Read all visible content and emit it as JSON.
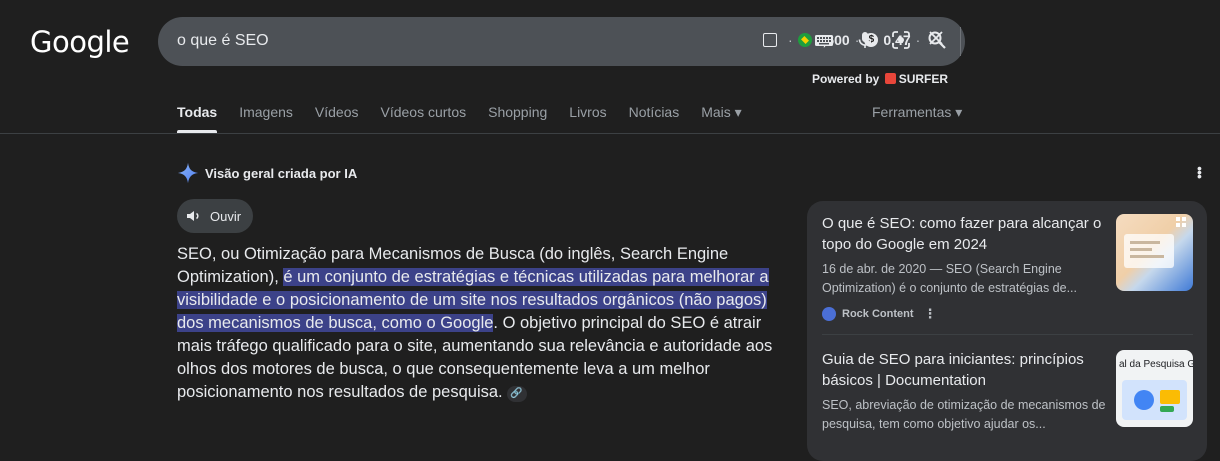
{
  "header": {
    "logo": "Google",
    "query": "o que é SEO",
    "ext_volume": "6,600",
    "ext_cpc": "0.47",
    "dot": "·",
    "powered_by": "Powered by",
    "surfer": "SURFER"
  },
  "tabs": [
    {
      "label": "Todas",
      "active": true
    },
    {
      "label": "Imagens"
    },
    {
      "label": "Vídeos"
    },
    {
      "label": "Vídeos curtos"
    },
    {
      "label": "Shopping"
    },
    {
      "label": "Livros"
    },
    {
      "label": "Notícias"
    },
    {
      "label": "Mais ▾"
    }
  ],
  "tools_label": "Ferramentas ▾",
  "ai": {
    "title": "Visão geral criada por IA",
    "listen": "Ouvir",
    "text_a": "SEO, ou Otimização para Mecanismos de Busca (do inglês, Search Engine Optimization), ",
    "text_highlight": "é um conjunto de estratégias e técnicas utilizadas para melhorar a visibilidade e o posicionamento de um site nos resultados orgânicos (não pagos) dos mecanismos de busca, como o Google",
    "text_b": ". O objetivo principal do SEO é atrair mais tráfego qualificado para o site, aumentando sua relevância e autoridade aos olhos dos motores de busca, o que consequentemente leva a um melhor posicionamento nos resultados de pesquisa."
  },
  "sources": [
    {
      "title": "O que é SEO: como fazer para alcançar o topo do Google em 2024",
      "desc": "16 de abr. de 2020 — SEO (Search Engine Optimization) é o conjunto de estratégias de...",
      "site": "Rock Content"
    },
    {
      "title": "Guia de SEO para iniciantes: princípios básicos | Documentation",
      "desc": "SEO, abreviação de otimização de mecanismos de pesquisa, tem como objetivo ajudar os...",
      "thumb_text": "al da Pesquisa G"
    }
  ],
  "icons": {
    "listen": "speaker-icon",
    "spark": "ai-sparkle-icon",
    "keyboard": "keyboard-icon",
    "mic": "mic-icon",
    "lens": "lens-icon",
    "search": "search-icon",
    "close": "close-icon",
    "link": "link-icon"
  },
  "colors": {
    "background": "#1f1f1f",
    "search_bar": "#4d5156",
    "highlight": "#3c4289",
    "card": "#303134",
    "surfer": "#e8463a"
  }
}
